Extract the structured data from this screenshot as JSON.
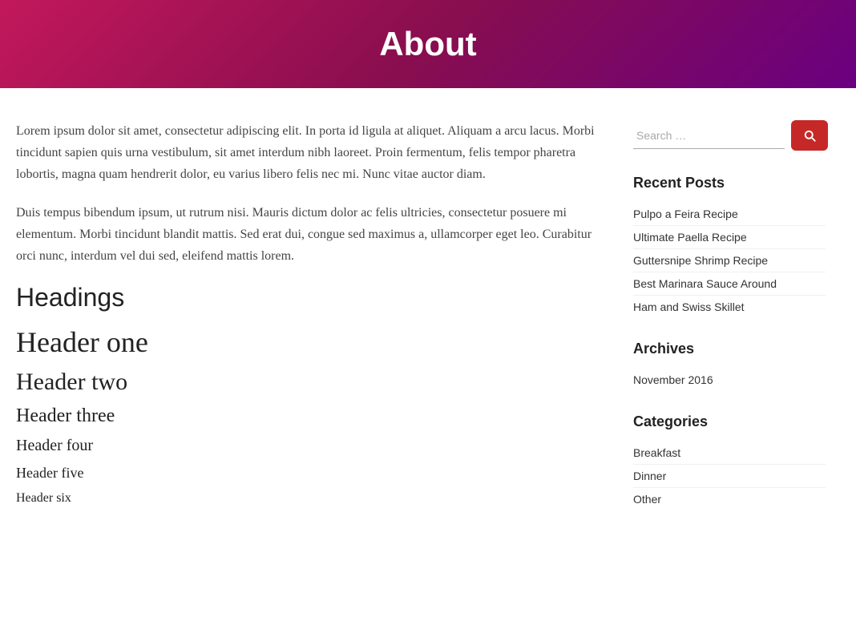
{
  "header": {
    "title": "About"
  },
  "main": {
    "paragraph1": "Lorem ipsum dolor sit amet, consectetur adipiscing elit. In porta id ligula at aliquet. Aliquam a arcu lacus. Morbi tincidunt sapien quis urna vestibulum, sit amet interdum nibh laoreet. Proin fermentum, felis tempor pharetra lobortis, magna quam hendrerit dolor, eu varius libero felis nec mi. Nunc vitae auctor diam.",
    "paragraph2": "Duis tempus bibendum ipsum, ut rutrum nisi. Mauris dictum dolor ac felis ultricies, consectetur posuere mi elementum. Morbi tincidunt blandit mattis. Sed erat dui, congue sed maximus a, ullamcorper eget leo. Curabitur orci nunc, interdum vel dui sed, eleifend mattis lorem.",
    "headings_label": "Headings",
    "header_one": "Header one",
    "header_two": "Header two",
    "header_three": "Header three",
    "header_four": "Header four",
    "header_five": "Header five",
    "header_six": "Header six"
  },
  "sidebar": {
    "search_placeholder": "Search …",
    "search_btn_label": "Search",
    "recent_posts_title": "Recent Posts",
    "recent_posts": [
      {
        "label": "Pulpo a Feira Recipe"
      },
      {
        "label": "Ultimate Paella Recipe"
      },
      {
        "label": "Guttersnipe Shrimp Recipe"
      },
      {
        "label": "Best Marinara Sauce Around"
      },
      {
        "label": "Ham and Swiss Skillet"
      }
    ],
    "archives_title": "Archives",
    "archives": [
      {
        "label": "November 2016"
      }
    ],
    "categories_title": "Categories",
    "categories": [
      {
        "label": "Breakfast"
      },
      {
        "label": "Dinner"
      },
      {
        "label": "Other"
      }
    ]
  }
}
